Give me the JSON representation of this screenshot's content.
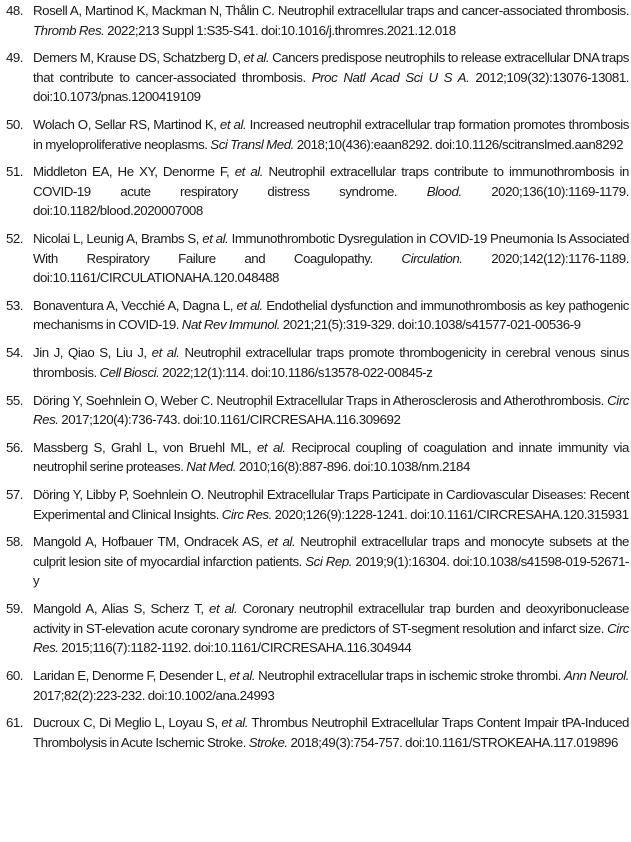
{
  "references": [
    {
      "num": "48.",
      "text_before": "Rosell A, Martinod K, Mackman N, Thålin C. Neutrophil extracellular traps and cancer-associated thrombosis.",
      "journal": "Thromb Res.",
      "text_after": "2022;213 Suppl 1:S35-S41. doi:10.1016/j.thromres.2021.12.018"
    },
    {
      "num": "49.",
      "text_before": "Demers M, Krause DS, Schatzberg D,",
      "etal": "et al.",
      "text_mid": "Cancers predispose neutrophils to release extracellular DNA traps that contribute to cancer-associated thrombosis.",
      "journal": "Proc Natl Acad Sci U S A.",
      "text_after": "2012;109(32):13076-13081. doi:10.1073/pnas.1200419109"
    },
    {
      "num": "50.",
      "text_before": "Wolach O, Sellar RS, Martinod K,",
      "etal": "et al.",
      "text_mid": "Increased neutrophil extracellular trap formation promotes thrombosis in myeloproliferative neoplasms.",
      "journal": "Sci Transl Med.",
      "text_after": "2018;10(436):eaan8292. doi:10.1126/scitranslmed.aan8292"
    },
    {
      "num": "51.",
      "text_before": "Middleton EA, He XY, Denorme F,",
      "etal": "et al.",
      "text_mid": "Neutrophil extracellular traps contribute to immunothrombosis in COVID-19 acute respiratory distress syndrome.",
      "journal": "Blood.",
      "text_after": "2020;136(10):1169-1179. doi:10.1182/blood.2020007008"
    },
    {
      "num": "52.",
      "text_before": "Nicolai L, Leunig A, Brambs S,",
      "etal": "et al.",
      "text_mid": "Immunothrombotic Dysregulation in COVID-19 Pneumonia Is Associated With Respiratory Failure and Coagulopathy.",
      "journal": "Circulation.",
      "text_after": "2020;142(12):1176-1189. doi:10.1161/CIRCULATIONAHA.120.048488"
    },
    {
      "num": "53.",
      "text_before": "Bonaventura A, Vecchié A, Dagna L,",
      "etal": "et al.",
      "text_mid": "Endothelial dysfunction and immunothrombosis as key pathogenic mechanisms in COVID-19.",
      "journal": "Nat Rev Immunol.",
      "text_after": "2021;21(5):319-329. doi:10.1038/s41577-021-00536-9"
    },
    {
      "num": "54.",
      "text_before": "Jin J, Qiao S, Liu J,",
      "etal": "et al.",
      "text_mid": "Neutrophil extracellular traps promote thrombogenicity in cerebral venous sinus thrombosis.",
      "journal": "Cell Biosci.",
      "text_after": "2022;12(1):114. doi:10.1186/s13578-022-00845-z"
    },
    {
      "num": "55.",
      "text_before": "Döring Y, Soehnlein O, Weber C. Neutrophil Extracellular Traps in Atherosclerosis and Atherothrombosis.",
      "journal": "Circ Res.",
      "text_after": "2017;120(4):736-743. doi:10.1161/CIRCRESAHA.116.309692"
    },
    {
      "num": "56.",
      "text_before": "Massberg S, Grahl L, von Bruehl ML,",
      "etal": "et al.",
      "text_mid": "Reciprocal coupling of coagulation and innate immunity via neutrophil serine proteases.",
      "journal": "Nat Med.",
      "text_after": "2010;16(8):887-896. doi:10.1038/nm.2184"
    },
    {
      "num": "57.",
      "text_before": "Döring Y, Libby P, Soehnlein O. Neutrophil Extracellular Traps Participate in Cardiovascular Diseases: Recent Experimental and Clinical Insights.",
      "journal": "Circ Res.",
      "text_after": "2020;126(9):1228-1241. doi:10.1161/CIRCRESAHA.120.315931"
    },
    {
      "num": "58.",
      "text_before": "Mangold A, Hofbauer TM, Ondracek AS,",
      "etal": "et al.",
      "text_mid": "Neutrophil extracellular traps and monocyte subsets at the culprit lesion site of myocardial infarction patients.",
      "journal": "Sci Rep.",
      "text_after": "2019;9(1):16304. doi:10.1038/s41598-019-52671-y"
    },
    {
      "num": "59.",
      "text_before": "Mangold A, Alias S, Scherz T,",
      "etal": "et al.",
      "text_mid": "Coronary neutrophil extracellular trap burden and deoxyribonuclease activity in ST-elevation acute coronary syndrome are predictors of ST-segment resolution and infarct size.",
      "journal": "Circ Res.",
      "text_after": "2015;116(7):1182-1192. doi:10.1161/CIRCRESAHA.116.304944"
    },
    {
      "num": "60.",
      "text_before": "Laridan E, Denorme F, Desender L,",
      "etal": "et al.",
      "text_mid": "Neutrophil extracellular traps in ischemic stroke thrombi.",
      "journal": "Ann Neurol.",
      "text_after": "2017;82(2):223-232. doi:10.1002/ana.24993"
    },
    {
      "num": "61.",
      "text_before": "Ducroux C, Di Meglio L, Loyau S,",
      "etal": "et al.",
      "text_mid": "Thrombus Neutrophil Extracellular Traps Content Impair tPA-Induced Thrombolysis in Acute Ischemic Stroke.",
      "journal": "Stroke.",
      "text_after": "2018;49(3):754-757. doi:10.1161/STROKEAHA.117.019896"
    }
  ]
}
